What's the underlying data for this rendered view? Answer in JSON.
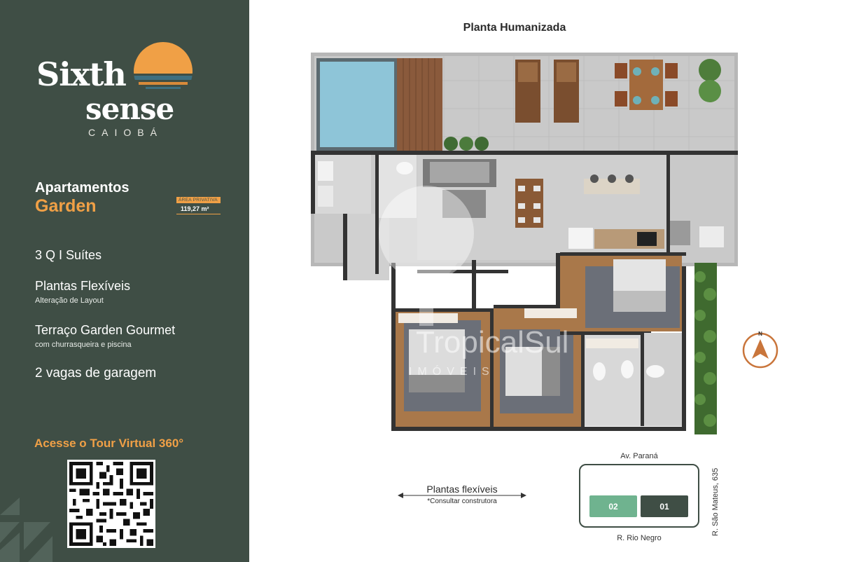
{
  "brand": {
    "line1": "Sixth",
    "line2": "sense",
    "city": "CAIOBÁ",
    "colors": {
      "panel": "#3f4e45",
      "accent": "#f0a046",
      "sun_blue": "#3f6f80"
    }
  },
  "apartment": {
    "title": "Apartamentos",
    "subtitle": "Garden",
    "area_label": "ÁREA PRIVATIVA",
    "area_value": "119,27 m²"
  },
  "features": [
    {
      "title": "3 Q I Suítes",
      "detail": ""
    },
    {
      "title": "Plantas Flexíveis",
      "detail": "Alteração de Layout"
    },
    {
      "title": "Terraço Garden Gourmet",
      "detail": "com churrasqueira e piscina"
    },
    {
      "title": "2 vagas de garagem",
      "detail": ""
    }
  ],
  "tour": {
    "label": "Acesse o Tour Virtual 360°",
    "icon": "qr-code-icon"
  },
  "plan": {
    "title": "Planta Humanizada",
    "compass_letter": "N",
    "watermark_text": "TropicalSul",
    "watermark_sub": "IMÓVEIS"
  },
  "flexible": {
    "label": "Plantas flexíveis",
    "note": "*Consultar construtora"
  },
  "site_map": {
    "street_top": "Av. Paraná",
    "street_bottom": "R. Rio Negro",
    "street_side": "R. São Mateus, 635",
    "units": [
      "02",
      "01"
    ]
  }
}
